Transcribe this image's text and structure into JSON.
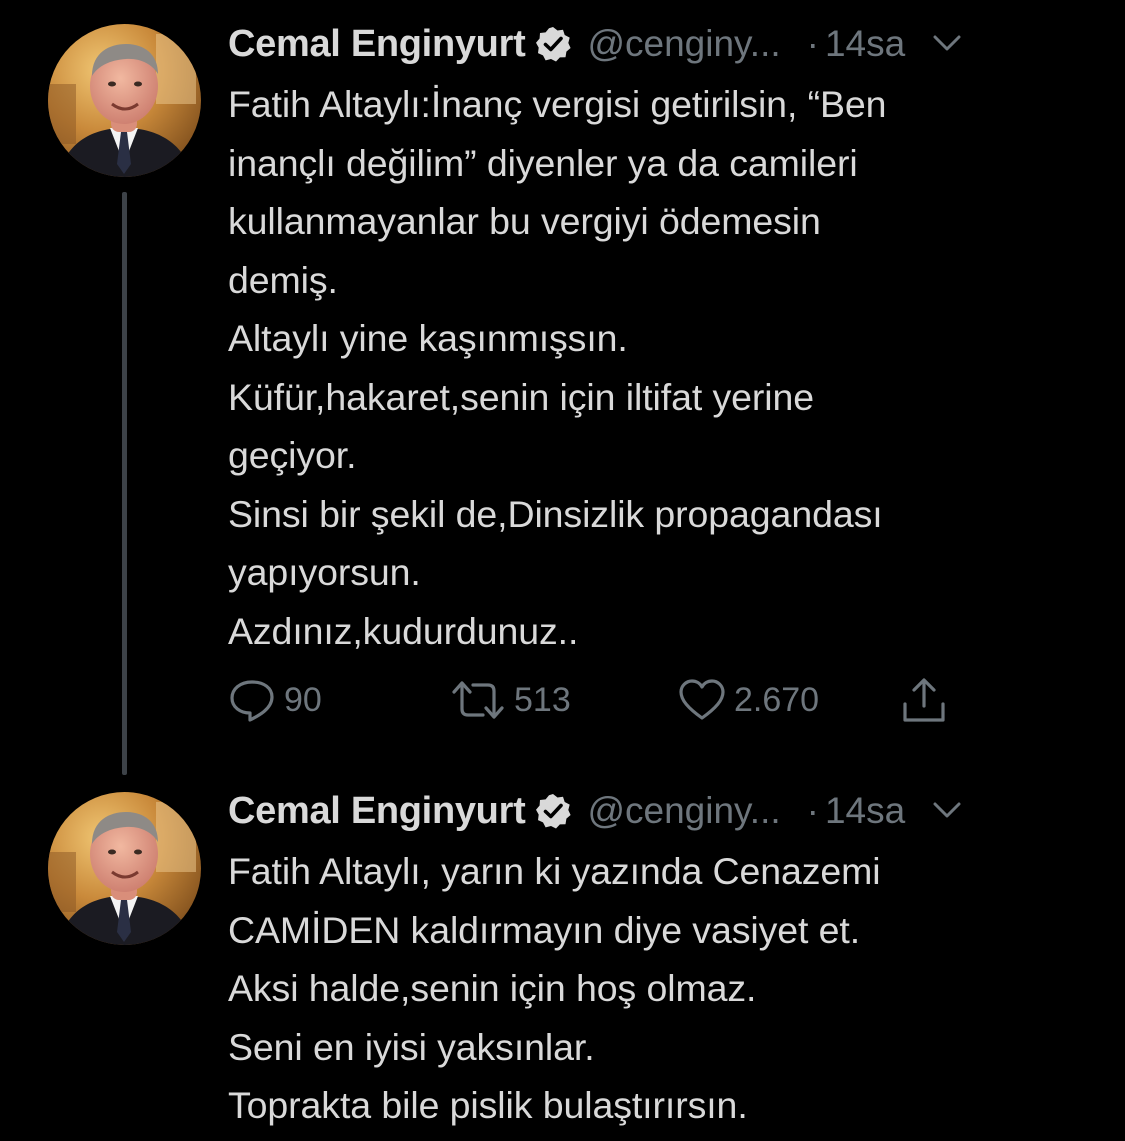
{
  "accent_color": "#D9D9D9",
  "muted_color": "#6E767D",
  "background_color": "#000000",
  "tweets": [
    {
      "author_name": "Cemal Enginyurt",
      "handle": "@cenginy...",
      "dot": "·",
      "time": "14sa",
      "verified_icon": "verified-badge-icon",
      "text": "Fatih Altaylı:İnanç vergisi getirilsin, “Ben\ninançlı değilim” diyenler ya da camileri\nkullanmayanlar bu vergiyi ödemesin\ndemiş.\nAltaylı yine kaşınmışsın.\nKüfür,hakaret,senin için iltifat yerine\ngeçiyor.\nSinsi bir şekil de,Dinsizlik propagandası\nyapıyorsun.\nAzdınız,kudurdunuz..",
      "replies": "90",
      "retweets": "513",
      "likes": "2.670"
    },
    {
      "author_name": "Cemal Enginyurt",
      "handle": "@cenginy...",
      "dot": "·",
      "time": "14sa",
      "verified_icon": "verified-badge-icon",
      "text": "Fatih Altaylı, yarın ki yazında Cenazemi\nCAMİDEN kaldırmayın diye vasiyet et.\nAksi halde,senin için hoş olmaz.\nSeni en iyisi yaksınlar.\nToprakta bile pislik bulaştırırsın."
    }
  ],
  "icons": {
    "reply": "reply-bubble-icon",
    "retweet": "retweet-arrows-icon",
    "like": "heart-icon",
    "share": "share-upload-icon",
    "menu": "chevron-down-icon"
  }
}
